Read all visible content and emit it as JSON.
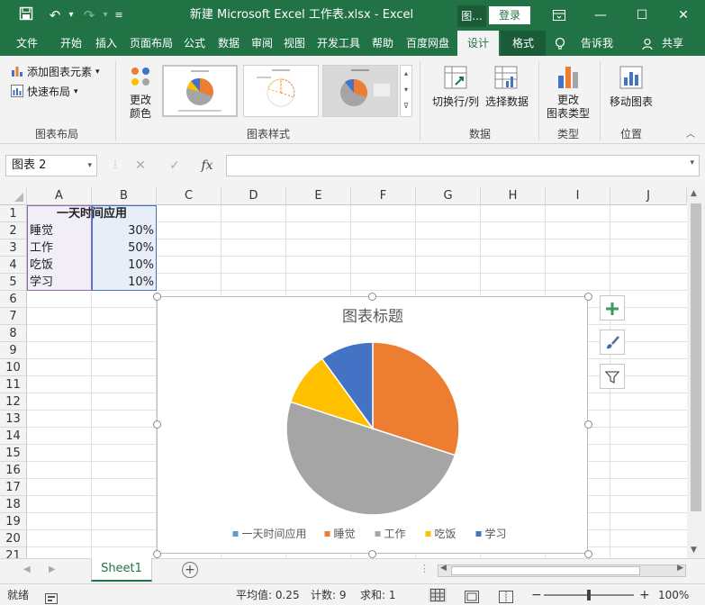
{
  "app": {
    "title": "新建 Microsoft Excel 工作表.xlsx  -  Excel",
    "context_tab": "图...",
    "login": "登录"
  },
  "menu": {
    "tabs": [
      "文件",
      "开始",
      "插入",
      "页面布局",
      "公式",
      "数据",
      "审阅",
      "视图",
      "开发工具",
      "帮助",
      "百度网盘",
      "设计",
      "格式"
    ],
    "tell_me": "告诉我",
    "share": "共享"
  },
  "ribbon": {
    "add_element": "添加图表元素",
    "quick_layout": "快速布局",
    "group_layout": "图表布局",
    "change_color": "更改\n颜色",
    "group_styles": "图表样式",
    "switch_rowcol": "切换行/列",
    "select_data": "选择数据",
    "group_data": "数据",
    "change_type": "更改\n图表类型",
    "group_type": "类型",
    "move_chart": "移动图表",
    "group_location": "位置"
  },
  "formula_bar": {
    "name_box": "图表 2",
    "fx": "fx",
    "value": ""
  },
  "grid": {
    "columns": [
      "A",
      "B",
      "C",
      "D",
      "E",
      "F",
      "G",
      "H",
      "I",
      "J"
    ],
    "rows": [
      "1",
      "2",
      "3",
      "4",
      "5",
      "6",
      "7",
      "8",
      "9",
      "10",
      "11",
      "12",
      "13",
      "14",
      "15",
      "16",
      "17",
      "18",
      "19",
      "20",
      "21"
    ],
    "cells": {
      "A1": "一天时间应用",
      "A2": "睡觉",
      "B2": "30%",
      "A3": "工作",
      "B3": "50%",
      "A4": "吃饭",
      "B4": "10%",
      "A5": "学习",
      "B5": "10%"
    }
  },
  "chart_data": {
    "type": "pie",
    "title": "图表标题",
    "categories": [
      "睡觉",
      "工作",
      "吃饭",
      "学习"
    ],
    "values": [
      0.3,
      0.5,
      0.1,
      0.1
    ],
    "colors": [
      "#ed7d31",
      "#a5a5a5",
      "#ffc000",
      "#4472c4"
    ],
    "legend": [
      {
        "label": "一天时间应用",
        "color": "#5b9bd5"
      },
      {
        "label": "睡觉",
        "color": "#ed7d31"
      },
      {
        "label": "工作",
        "color": "#a5a5a5"
      },
      {
        "label": "吃饭",
        "color": "#ffc000"
      },
      {
        "label": "学习",
        "color": "#4472c4"
      }
    ],
    "legend_position": "bottom"
  },
  "sheets": {
    "tabs": [
      "Sheet1"
    ]
  },
  "status": {
    "ready": "就绪",
    "average": "平均值: 0.25",
    "count": "计数: 9",
    "sum": "求和: 1",
    "zoom": "100%"
  }
}
